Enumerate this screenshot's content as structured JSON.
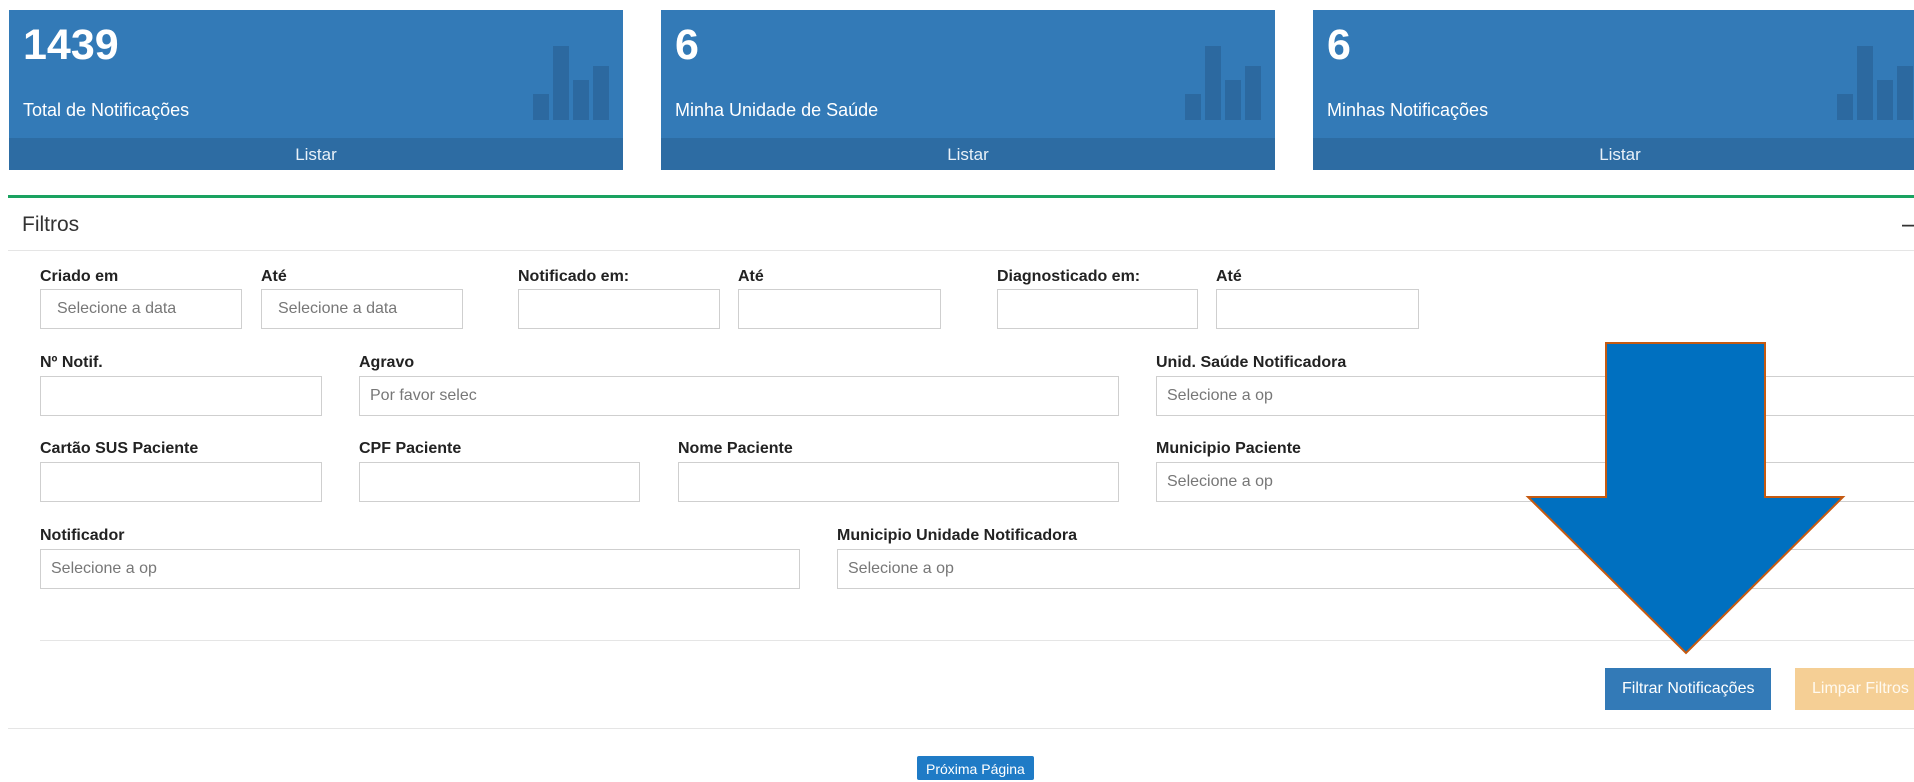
{
  "cards": [
    {
      "value": "1439",
      "label": "Total de Notificações",
      "action": "Listar"
    },
    {
      "value": "6",
      "label": "Minha Unidade de Saúde",
      "action": "Listar"
    },
    {
      "value": "6",
      "label": "Minhas Notificações",
      "action": "Listar"
    }
  ],
  "filters": {
    "title": "Filtros",
    "collapse_symbol": "—",
    "criado_label": "Criado em",
    "criado_placeholder": "Selecione a data",
    "criado_ate_label": "Até",
    "criado_ate_placeholder": "Selecione a data",
    "notificado_label": "Notificado em:",
    "notificado_ate_label": "Até",
    "diagnosticado_label": "Diagnosticado em:",
    "diagnosticado_ate_label": "Até",
    "num_notif_label": "Nº Notif.",
    "agravo_label": "Agravo",
    "agravo_placeholder": "Por favor selec",
    "unid_saude_label": "Unid. Saúde Notificadora",
    "unid_saude_placeholder": "Selecione a op",
    "cartao_sus_label": "Cartão SUS Paciente",
    "cpf_label": "CPF Paciente",
    "nome_label": "Nome Paciente",
    "municipio_paciente_label": "Municipio Paciente",
    "municipio_paciente_placeholder": "Selecione a op",
    "notificador_label": "Notificador",
    "notificador_placeholder": "Selecione a op",
    "municipio_unidade_label": "Municipio Unidade Notificadora",
    "municipio_unidade_placeholder": "Selecione a op",
    "filtrar_button": "Filtrar Notificações",
    "limpar_button": "Limpar Filtros"
  },
  "pagination": {
    "next_label": "Próxima Página"
  },
  "colors": {
    "card_blue": "#337ab7",
    "card_footer": "#2d6ca3",
    "panel_accent": "#1aa260",
    "arrow_blue": "#0070c0",
    "arrow_outline": "#c55a11",
    "warning_button": "#f5cf95"
  },
  "icons": {
    "card_icon": "bar-chart-icon",
    "annotation": "down-arrow-annotation"
  }
}
